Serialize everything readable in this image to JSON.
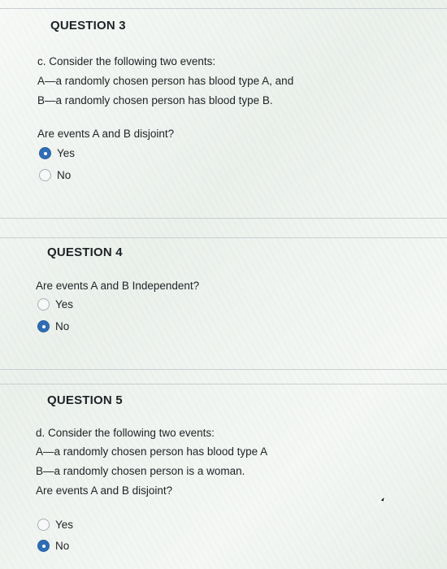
{
  "q3": {
    "title": "QUESTION 3",
    "lines": [
      "c. Consider the following two events:",
      "A—a randomly chosen person has blood type A, and",
      "B—a randomly chosen person has blood type B."
    ],
    "prompt": "Are events A and B disjoint?",
    "options": [
      {
        "label": "Yes",
        "selected": true
      },
      {
        "label": "No",
        "selected": false
      }
    ]
  },
  "q4": {
    "title": "QUESTION 4",
    "prompt": "Are events A and B Independent?",
    "options": [
      {
        "label": "Yes",
        "selected": false
      },
      {
        "label": "No",
        "selected": true
      }
    ]
  },
  "q5": {
    "title": "QUESTION 5",
    "lines": [
      "d. Consider the following two events:",
      "A—a randomly chosen person has blood type A",
      "B—a randomly chosen person is a woman.",
      "Are events A and B disjoint?"
    ],
    "options": [
      {
        "label": "Yes",
        "selected": false
      },
      {
        "label": "No",
        "selected": true
      }
    ]
  },
  "colors": {
    "radio_selected": "#2f6db6",
    "divider": "#c9ced2"
  },
  "icons": {
    "cursor": "arrow-cursor-icon"
  }
}
